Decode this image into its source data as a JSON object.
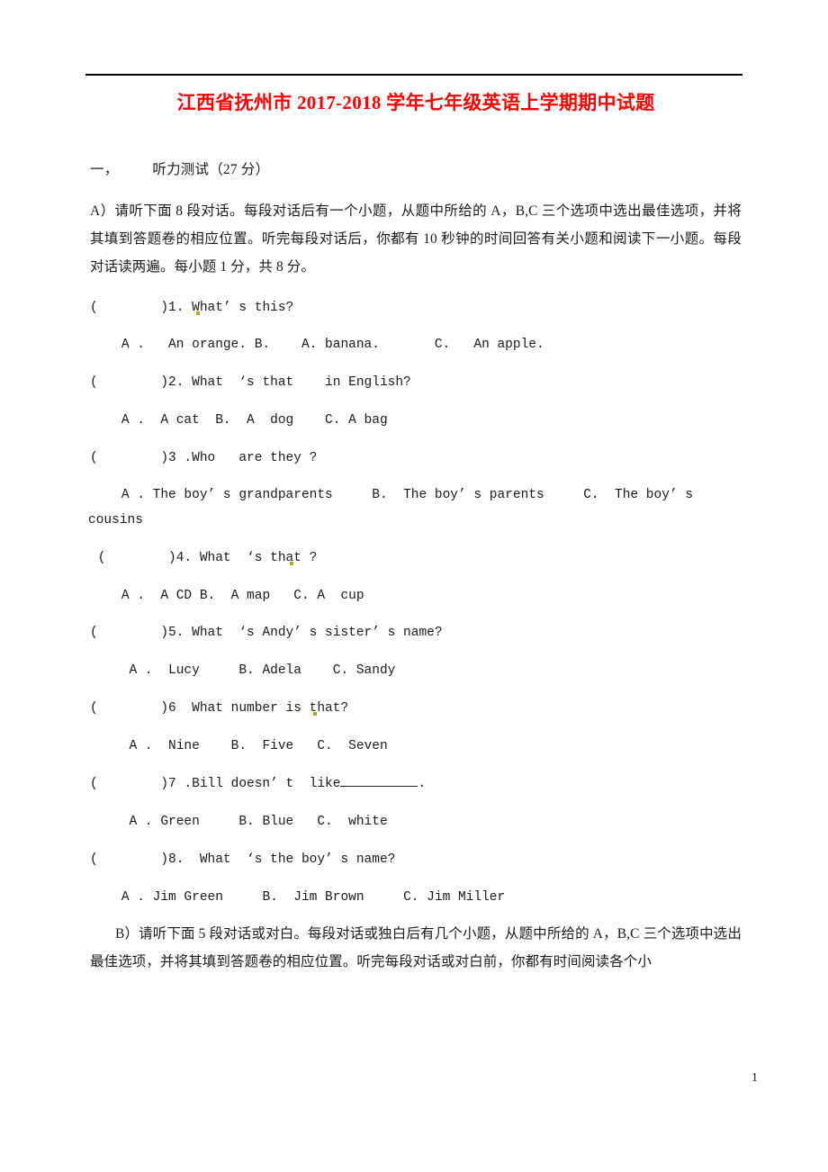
{
  "document": {
    "title": "江西省抚州市 2017-2018 学年七年级英语上学期期中试题",
    "title_color": "#ff0000",
    "page_number": "1"
  },
  "section": {
    "number": "一，",
    "label": "听力测试（27 分）"
  },
  "instructions": {
    "part_a": "A）请听下面 8 段对话。每段对话后有一个小题，从题中所给的 A，B,C 三个选项中选出最佳选项，并将其填到答题卷的相应位置。听完每段对话后，你都有 10 秒钟的时间回答有关小题和阅读下一小题。每段对话读两遍。每小题 1 分，共 8 分。",
    "part_b": "B）请听下面 5 段对话或对白。每段对话或独白后有几个小题，从题中所给的 A，B,C 三个选项中选出最佳选项，并将其填到答题卷的相应位置。听完每段对话或对白前，你都有时间阅读各个小"
  },
  "questions": [
    {
      "id": "q1",
      "bracket": "(        )",
      "stem_pre": "1. W",
      "has_mark": true,
      "stem_post": "hat’ s this?",
      "options": "    A .   An orange. B.    A. banana.       C.   An apple.",
      "continuation": ""
    },
    {
      "id": "q2",
      "bracket": "(        )",
      "stem_pre": "2. What  ‘s that    in English?",
      "has_mark": false,
      "stem_post": "",
      "options": "    A .  A cat  B.  A  dog    C. A bag",
      "continuation": ""
    },
    {
      "id": "q3",
      "bracket": "(        )",
      "stem_pre": "3 .Who   are they ?",
      "has_mark": false,
      "stem_post": "",
      "options": "    A . The boy’ s grandparents     B.  The boy’ s parents     C.  The boy’ s",
      "continuation": "cousins"
    },
    {
      "id": "q4",
      "bracket": " (        )",
      "stem_pre": "4. What  ‘s tha",
      "has_mark": true,
      "stem_post": "t ?",
      "options": "    A .  A CD B.  A map   C. A  cup",
      "continuation": ""
    },
    {
      "id": "q5",
      "bracket": "(        )",
      "stem_pre": "5. What  ‘s Andy’ s sister’ s name?",
      "has_mark": false,
      "stem_post": "",
      "options": "     A .  Lucy     B. Adela    C. Sandy",
      "continuation": ""
    },
    {
      "id": "q6",
      "bracket": "(        )",
      "stem_pre": "6  What number is t",
      "has_mark": true,
      "stem_post": "hat?",
      "options": "     A .  Nine    B.  Five   C.  Seven",
      "continuation": ""
    },
    {
      "id": "q7",
      "bracket": "(        )",
      "stem_pre": "7 .Bill doesn’ t  like",
      "has_mark": false,
      "stem_post": "",
      "has_blank": true,
      "stem_after_blank": ".",
      "options": "     A . Green     B. Blue   C.  white",
      "continuation": ""
    },
    {
      "id": "q8",
      "bracket": "(        )",
      "stem_pre": "8.  What  ‘s the boy’ s name?",
      "has_mark": false,
      "stem_post": "",
      "options": "    A . Jim Green     B.  Jim Brown     C. Jim Miller",
      "continuation": ""
    }
  ]
}
